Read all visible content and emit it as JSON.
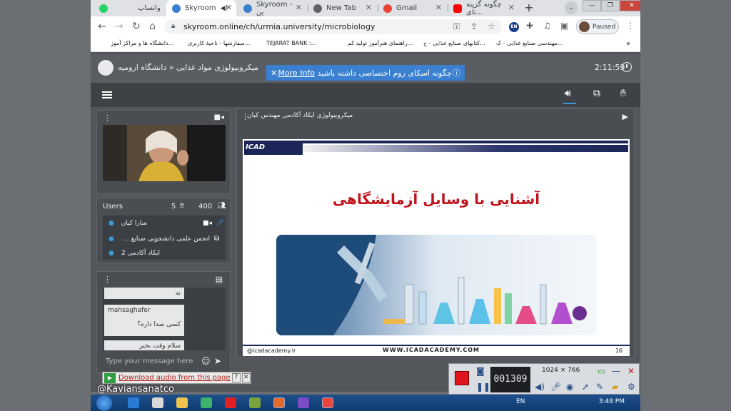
{
  "browser": {
    "tabs": [
      {
        "label": "واتساپ",
        "favicon_color": "#25d366",
        "active": false
      },
      {
        "label": "Skyroom",
        "favicon_color": "#3a7fd0",
        "active": true
      },
      {
        "label": "Skyroom - ین",
        "favicon_color": "#3a7fd0",
        "active": false
      },
      {
        "label": "New Tab",
        "favicon_color": "#5f6368",
        "active": false
      },
      {
        "label": "Gmail",
        "favicon_color": "#ea4335",
        "active": false
      },
      {
        "label": "چگونه گزینه تای...",
        "favicon_color": "#ff0000",
        "active": false
      }
    ],
    "url": "skyroom.online/ch/urmia.university/microbiology",
    "profile_status": "Paused",
    "extension_badge": "EN",
    "bookmarks": [
      {
        "label": "مهندسی صنایع غذایی - ک..."
      },
      {
        "label": "کتابهای صنایع غذایی - خ..."
      },
      {
        "label": "راهنمای هنرآموز تولید کم..."
      },
      {
        "label": "TEJARAT BANK :..."
      },
      {
        "label": "سفارشها - ناحیهٔ کاربری..."
      },
      {
        "label": "دانشگاه ها و مراکز آموز..."
      }
    ]
  },
  "skyroom": {
    "room_title": "میکروبیولوژی مواد غذایی « دانشگاه ارومیه",
    "timer": "2:11:59",
    "banner": {
      "text": "چگونه اسکای روم اختصاصی داشته باشید",
      "link": "More Info"
    },
    "slide_panel_title": "میکروبیولوژی ایکاد آکادمی مهندس کیان",
    "users": {
      "label": "Users",
      "hand_count": "5",
      "total": "400",
      "list": [
        {
          "name": "سارا کیان"
        },
        {
          "name": "انجمن علمی دانشجویی صنایع ..."
        },
        {
          "name": "ایکاد آکادمی 2"
        }
      ]
    },
    "chat": {
      "messages": [
        {
          "sender": "",
          "text": "نه"
        },
        {
          "sender": "mahsaghafer",
          "text": "کسی صدا داره؟"
        },
        {
          "sender": "",
          "text": "سلام وقت بخیر"
        }
      ],
      "placeholder": "Type your message here"
    }
  },
  "slide": {
    "logo": "ICAD Academy",
    "heading": "آشنایی با وسایل آزمایشگاهی",
    "instagram": "@icadacademy.ir",
    "website": "WWW.ICADACADEMY.COM",
    "page_number": "16"
  },
  "overlay": {
    "watermark": "@Kaviansanatco",
    "download_audio": "Download audio from this page",
    "recorder_counter": "001309",
    "recorder_dimensions": "1024 × 766"
  },
  "taskbar": {
    "language": "EN",
    "time": "3:48 PM"
  }
}
